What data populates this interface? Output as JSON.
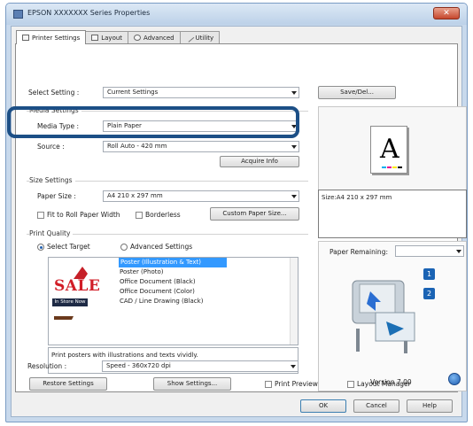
{
  "window": {
    "title": "EPSON XXXXXXX Series Properties",
    "close_symbol": "✕"
  },
  "tabs": [
    {
      "label": "Printer Settings",
      "icon": "printer-icon"
    },
    {
      "label": "Layout",
      "icon": "layout-icon"
    },
    {
      "label": "Advanced",
      "icon": "advanced-icon"
    },
    {
      "label": "Utility",
      "icon": "utility-icon"
    }
  ],
  "select_setting": {
    "label": "Select Setting :",
    "value": "Current Settings",
    "save_del_button": "Save/Del..."
  },
  "media_settings": {
    "title": "Media Settings",
    "media_type_label": "Media Type :",
    "media_type_value": "Plain Paper",
    "source_label": "Source :",
    "source_value": "Roll Auto - 420 mm",
    "acquire_button": "Acquire Info"
  },
  "size_settings": {
    "title": "Size Settings",
    "paper_size_label": "Paper Size :",
    "paper_size_value": "A4 210 x 297 mm",
    "fit_roll_label": "Fit to Roll Paper Width",
    "borderless_label": "Borderless",
    "custom_button": "Custom Paper Size..."
  },
  "print_quality": {
    "title": "Print Quality",
    "select_target_label": "Select Target",
    "advanced_label": "Advanced Settings",
    "targets": [
      "Poster (Illustration & Text)",
      "Poster (Photo)",
      "Office Document (Black)",
      "Office Document (Color)",
      "CAD / Line Drawing (Black)"
    ],
    "selected_index": 0,
    "sale_text": "SALE",
    "in_store_text": "In Store Now",
    "description": "Print posters with illustrations and texts vividly.",
    "resolution_label": "Resolution :",
    "resolution_value": "Speed - 360x720 dpi"
  },
  "preview": {
    "paper_letter": "A",
    "size_text": "Size:A4 210 x 297 mm",
    "paper_remaining_label": "Paper Remaining:",
    "version": "Version 7.00",
    "badge_1": "1",
    "badge_2": "2"
  },
  "bottom_row": {
    "restore_button": "Restore Settings",
    "show_settings_button": "Show Settings...",
    "print_preview_label": "Print Preview",
    "layout_manager_label": "Layout Manager"
  },
  "dialog_buttons": {
    "ok": "OK",
    "cancel": "Cancel",
    "help": "Help"
  },
  "colors": {
    "highlight": "#1c4f86",
    "selection": "#3399ff",
    "sale_red": "#d11d27"
  }
}
